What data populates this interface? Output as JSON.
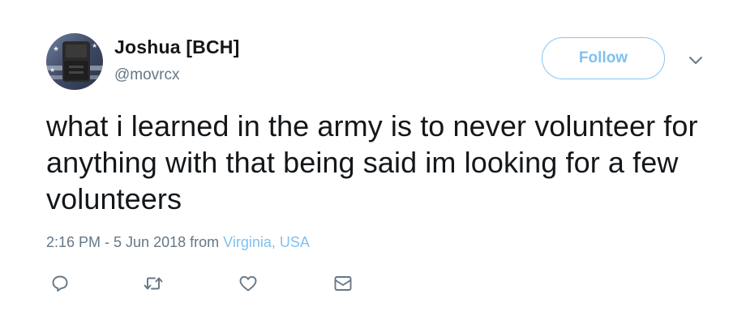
{
  "tweet": {
    "author": {
      "display_name": "Joshua [BCH]",
      "handle": "@movrcx",
      "avatar_icon": "avatar-photo"
    },
    "follow_label": "Follow",
    "more_icon": "chevron-down-icon",
    "text": "what i learned in the army is to never volunteer for anything with that being said im looking for a few volunteers",
    "timestamp": "2:16 PM - 5 Jun 2018",
    "from_label": "from",
    "location": "Virginia, USA",
    "actions": [
      {
        "name": "reply",
        "icon": "reply-icon"
      },
      {
        "name": "retweet",
        "icon": "retweet-icon"
      },
      {
        "name": "like",
        "icon": "heart-icon"
      },
      {
        "name": "message",
        "icon": "envelope-icon"
      }
    ]
  },
  "colors": {
    "text": "#14171a",
    "secondary": "#657786",
    "accent": "#7fc1ef",
    "button_border": "#86c6f4"
  }
}
